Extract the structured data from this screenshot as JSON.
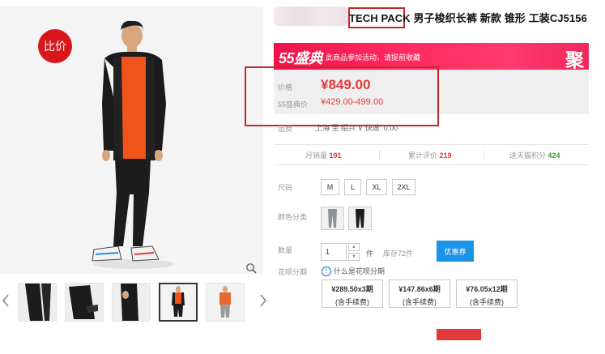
{
  "gallery": {
    "compare_badge": "比价",
    "thumb_count": 5,
    "active_thumb": 4
  },
  "product": {
    "title_visible": "TECH PACK 男子梭织长裤 新款 锥形 工装CJ5156"
  },
  "promo": {
    "logo": "55盛典",
    "text": "此商品参加活动，请提前收藏",
    "badge": "聚"
  },
  "price": {
    "label": "价格",
    "value": "¥849.00",
    "promo_label": "55盛典价",
    "promo_value": "¥429.00-499.00"
  },
  "shipping": {
    "label": "运费",
    "text": "上海 至 绍兴 ∨ 快递: 0.00"
  },
  "stats": {
    "monthly_label": "月销量",
    "monthly_value": "191",
    "reviews_label": "累计评价",
    "reviews_value": "219",
    "points_label": "送天猫积分",
    "points_value": "424"
  },
  "options": {
    "size_label": "尺码",
    "sizes": [
      "M",
      "L",
      "XL",
      "2XL"
    ],
    "color_label": "颜色分类",
    "quantity_label": "数量",
    "quantity_value": "1",
    "quantity_unit": "件",
    "stock_text": "库存72件",
    "coupon_button": "优惠券"
  },
  "installment": {
    "label": "花呗分期",
    "help": "什么是花呗分期",
    "plans": [
      {
        "amount": "¥289.50x3期",
        "fee": "(含手续费)"
      },
      {
        "amount": "¥147.86x6期",
        "fee": "(含手续费)"
      },
      {
        "amount": "¥76.05x12期",
        "fee": "(含手续费)"
      }
    ]
  },
  "colors": {
    "accent_red": "#e4393c",
    "badge_red": "#d8161b",
    "highlight_red": "#c8282b",
    "promo_pink": "#ff2a5f",
    "coupon_blue": "#1b93e9",
    "reviews_green": "#3a9a2c"
  }
}
